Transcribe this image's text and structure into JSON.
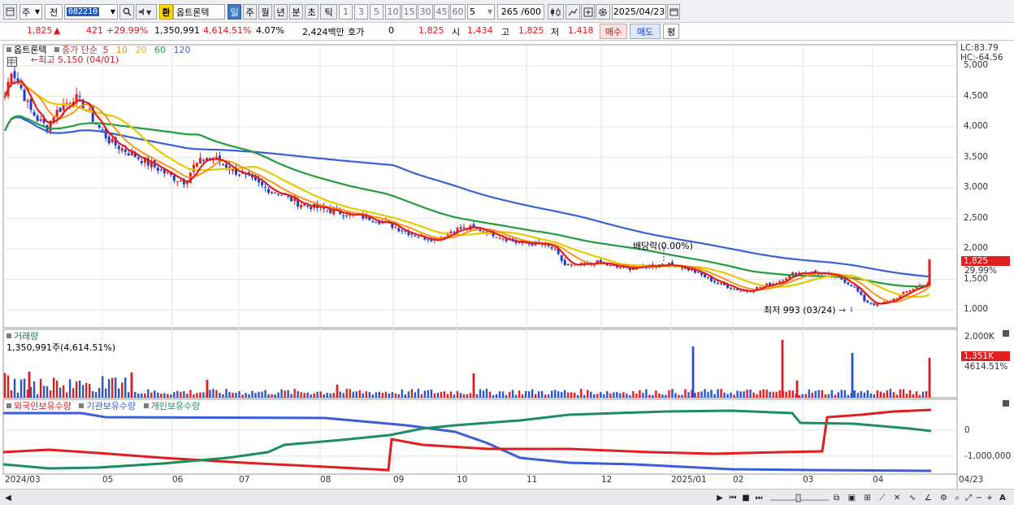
{
  "toolbar": {
    "market": "주",
    "all": "전",
    "code": "082210",
    "stock_name": "옵트론텍",
    "periods": [
      "일",
      "주",
      "월",
      "년",
      "분",
      "초",
      "틱"
    ],
    "active_period": "일",
    "minute_options": [
      "1",
      "3",
      "5",
      "10",
      "15",
      "30",
      "45",
      "60"
    ],
    "interval_value": "5",
    "count_display": "265 /600",
    "date": "2025/04/23",
    "exchange_label": "환"
  },
  "quote": {
    "price": "1,825",
    "change": "421",
    "change_pct": "+29.99%",
    "volume": "1,350,991",
    "volume_pct": "4,614.51%",
    "turnover_pct": "4.07%",
    "amount": "2,424백만",
    "bid_label": "호가",
    "bid_value": "0",
    "open_price": "1,825",
    "open_label": "시",
    "open_value": "1,434",
    "high_label": "고",
    "high_value": "1,825",
    "low_label": "저",
    "low_value": "1,418",
    "buy_button": "매수",
    "sell_button": "매도",
    "eval_button": "평"
  },
  "price_panel": {
    "stock_label": "옵트론텍",
    "ma_label": "종가 단순",
    "ma_periods": [
      "5",
      "10",
      "20",
      "60",
      "120"
    ],
    "ma_colors": [
      "#e01e1e",
      "#ff8c00",
      "#e8c800",
      "#1e9e3e",
      "#3a5fd8"
    ],
    "max_annotation": "최고 5,150 (04/01)",
    "min_annotation": "최저 993 (03/24)",
    "dividend_annotation": "배당락(0.00%)",
    "lc_label": "LC:83.79",
    "hc_label": "HC:-64.56",
    "price_badge": "1,825",
    "pct_badge": "29.99%",
    "y_ticks": [
      "5,000",
      "4,500",
      "4,000",
      "3,500",
      "3,000",
      "2,500",
      "2,000",
      "1,500",
      "1,000"
    ]
  },
  "volume_panel": {
    "title": "거래량",
    "current": "1,350,991주(4,614.51%)",
    "y_tick": "2,000K",
    "badge_value": "1,351K",
    "badge_pct": "4614.51%"
  },
  "holding_panel": {
    "series": [
      "외국인보유수량",
      "기관보유수량",
      "개인보유수량"
    ],
    "series_colors": [
      "#e01e1e",
      "#3a5fd8",
      "#1e8e5e"
    ],
    "y_ticks": [
      "0",
      "-1,000,000"
    ]
  },
  "x_axis": [
    "2024/03",
    "05",
    "06",
    "07",
    "08",
    "09",
    "10",
    "11",
    "12",
    "2025/01",
    "02",
    "03",
    "04",
    "04/23"
  ],
  "colors": {
    "up": "#e01e1e",
    "down": "#1a3fd0",
    "badge_red": "#e02020"
  }
}
